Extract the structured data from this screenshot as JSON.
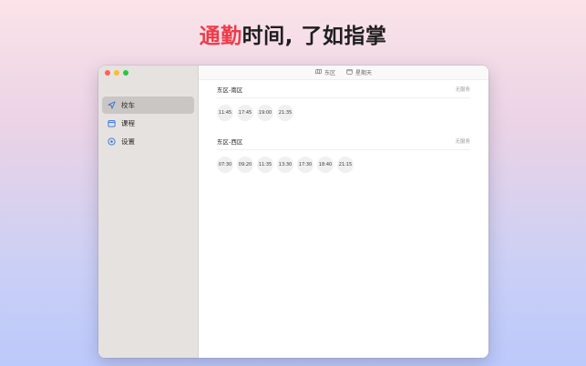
{
  "headline": {
    "accent": "通勤",
    "rest": "时间, 了如指掌"
  },
  "sidebar": {
    "items": [
      {
        "label": "校车",
        "icon": "location-arrow-icon",
        "active": true
      },
      {
        "label": "课程",
        "icon": "calendar-icon",
        "active": false
      },
      {
        "label": "设置",
        "icon": "settings-circle-icon",
        "active": false
      }
    ]
  },
  "toolbar": {
    "campus": {
      "label": "东区",
      "icon": "map-icon"
    },
    "day": {
      "label": "星期天",
      "icon": "calendar-icon"
    }
  },
  "routes": [
    {
      "name": "东区-南区",
      "status": "无服务",
      "times": [
        "11:45",
        "17:45",
        "19:00",
        "21:35"
      ]
    },
    {
      "name": "东区-西区",
      "status": "无服务",
      "times": [
        "07:30",
        "09:20",
        "11:35",
        "13:30",
        "17:30",
        "18:40",
        "21:15"
      ]
    }
  ],
  "colors": {
    "accent": "#ef3b49",
    "sidebar_bg": "#e6e2df",
    "active_item": "#c9c6c3"
  }
}
